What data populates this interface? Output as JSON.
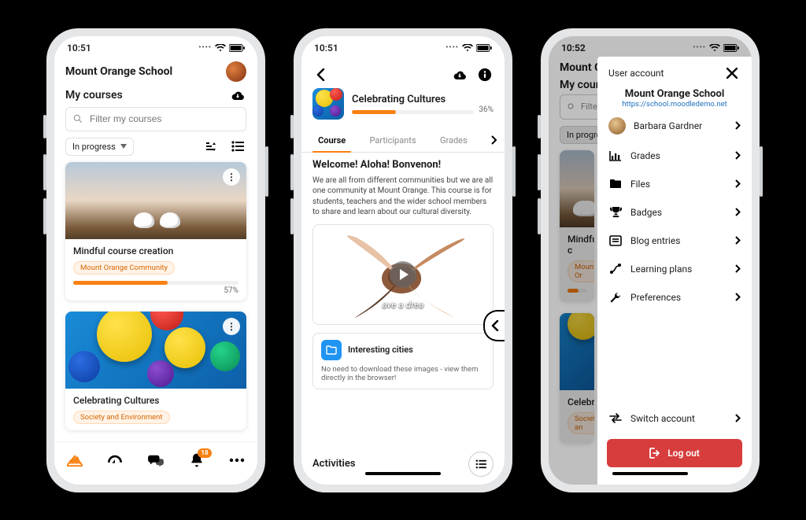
{
  "phone1": {
    "time": "10:51",
    "app_title": "Mount Orange School",
    "section": "My courses",
    "search_placeholder": "Filter my courses",
    "filter_label": "In progress",
    "cards": [
      {
        "title": "Mindful course creation",
        "tag": "Mount Orange Community",
        "progress": 57
      },
      {
        "title": "Celebrating Cultures",
        "tag": "Society and Environment",
        "progress": null
      }
    ],
    "badge_count": "18"
  },
  "phone2": {
    "time": "10:51",
    "course_title": "Celebrating Cultures",
    "progress": 36,
    "tabs": [
      "Course",
      "Participants",
      "Grades"
    ],
    "welcome": "Welcome! Aloha! Bonvenon!",
    "desc": "We are all from different communities but we are all one community at Mount Orange. This course is for students, teachers and the wider school members to share and learn about our cultural diversity.",
    "video_caption": "ave a drea",
    "resource": {
      "title": "Interesting cities",
      "desc": "No need to download these images - view them directly in the browser!"
    },
    "activities": "Activities"
  },
  "phone3": {
    "time": "10:52",
    "underlay": {
      "app_title": "Mount Or",
      "section": "My cour",
      "filter_hint": "Filte",
      "chip": "In progres",
      "card1": "Mindful c",
      "tag1": "Mount Or",
      "card2": "Celebrat",
      "tag2": "Society an"
    },
    "sheet_title": "User account",
    "school": "Mount Orange School",
    "url": "https://school.moodledemo.net",
    "user": "Barbara Gardner",
    "items": [
      "Grades",
      "Files",
      "Badges",
      "Blog entries",
      "Learning plans",
      "Preferences"
    ],
    "switch": "Switch account",
    "logout": "Log out"
  }
}
